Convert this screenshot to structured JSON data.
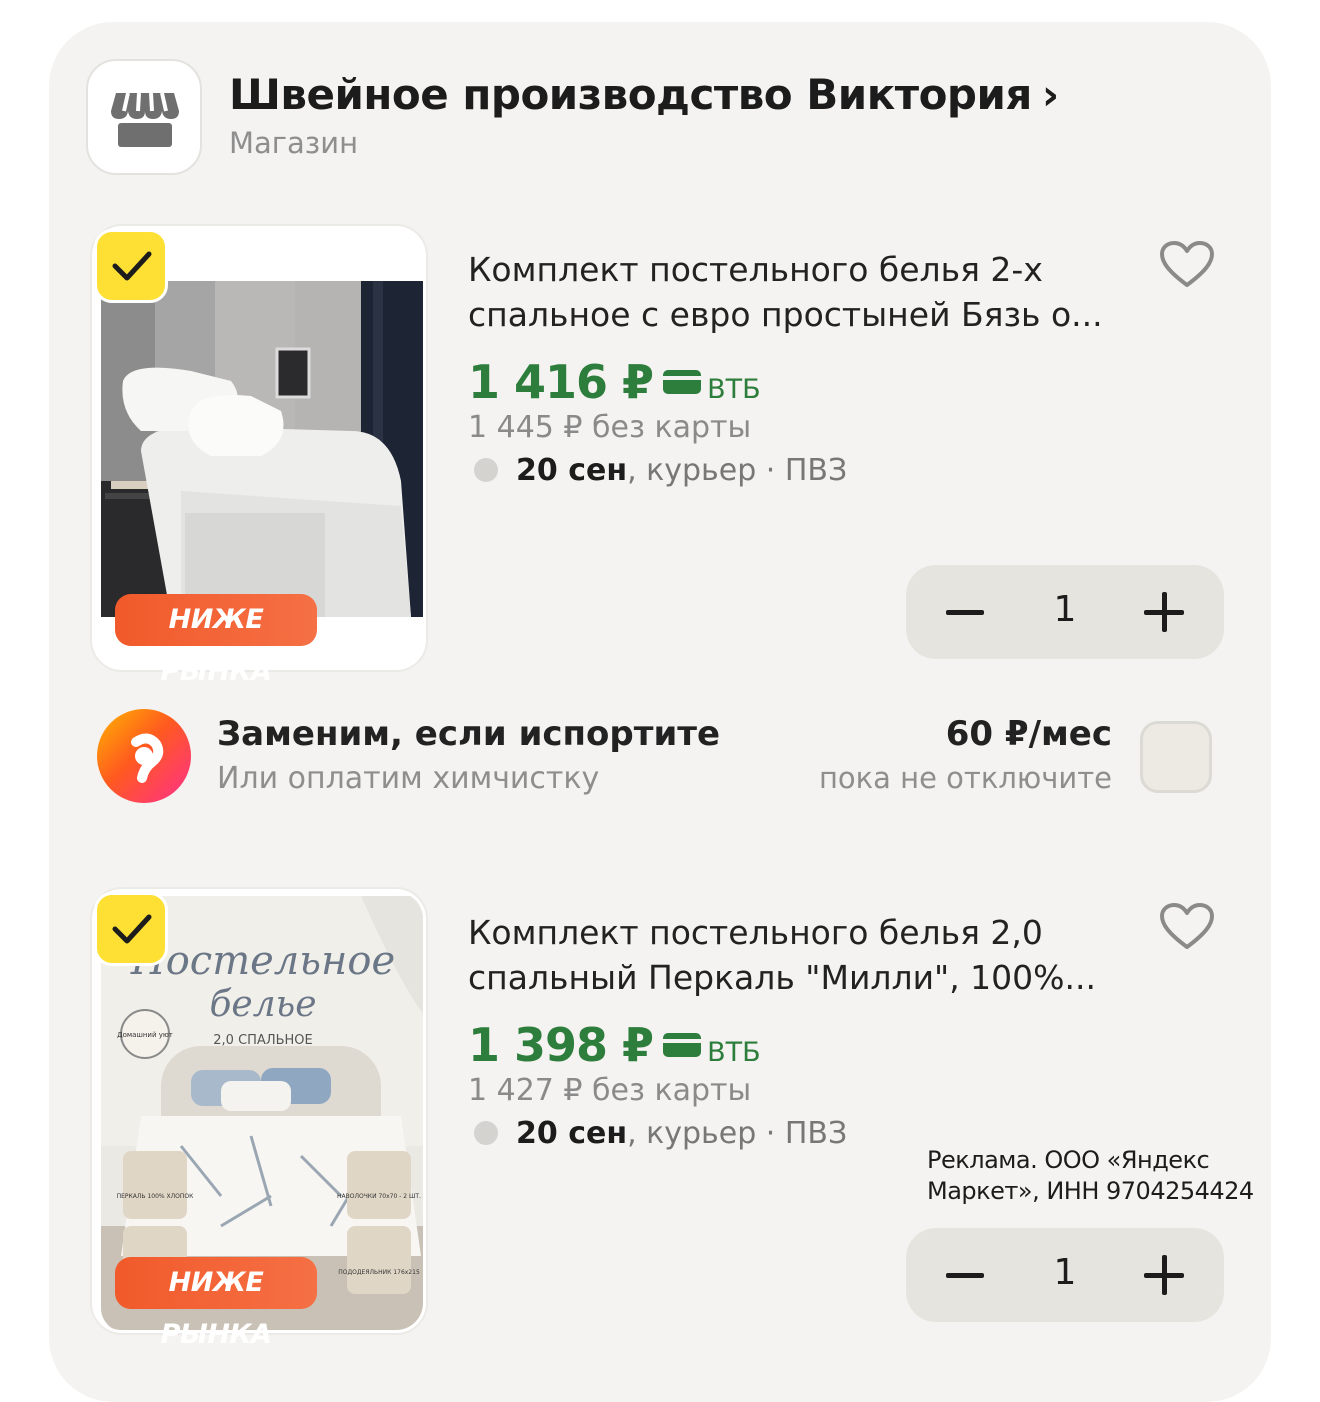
{
  "store": {
    "name": "Швейное производство Виктория",
    "chevron": "›",
    "type_label": "Магазин",
    "logo_icon": "storefront-icon"
  },
  "products": [
    {
      "title": "Комплект постельного белья 2-х спальное с евро простыней Бязь о...",
      "price": "1 416 ₽",
      "bank": "ВТБ",
      "old_price": "1 445 ₽  без карты",
      "delivery_date": "20 сен",
      "delivery_rest": ", курьер · ПВЗ",
      "badge": "НИЖЕ РЫНКА",
      "selected": true,
      "quantity": "1"
    },
    {
      "title": "Комплект постельного белья 2,0 спальный Перкаль \"Милли\", 100%...",
      "price": "1 398 ₽",
      "bank": "ВТБ",
      "old_price": "1 427 ₽  без карты",
      "delivery_date": "20 сен",
      "delivery_rest": ", курьер · ПВЗ",
      "badge": "НИЖЕ РЫНКА",
      "selected": true,
      "quantity": "1",
      "image_text": {
        "title1": "Постельное",
        "title2": "белье",
        "subtitle": "2,0 СПАЛЬНОЕ",
        "seal": "Домашний уют",
        "feature1": "ПЕРКАЛЬ 100% ХЛОПОК",
        "feature2": "НАВОЛОЧКИ 70х70 - 2 ШТ.",
        "feature3": "ПОДОДЕЯЛЬНИК 176х215"
      }
    }
  ],
  "insurance": {
    "title": "Заменим, если испортите",
    "subtitle": "Или оплатим химчистку",
    "price": "60 ₽/мес",
    "condition": "пока не отключите",
    "checked": false
  },
  "ad_disclaimer": {
    "line1": "Реклама. ООО «Яндекс",
    "line2": "Маркет», ИНН 9704254424"
  },
  "colors": {
    "card_bg": "#f4f3f1",
    "price_green": "#2d7d3c",
    "check_yellow": "#fde033",
    "badge_orange": "#f15a2b"
  }
}
